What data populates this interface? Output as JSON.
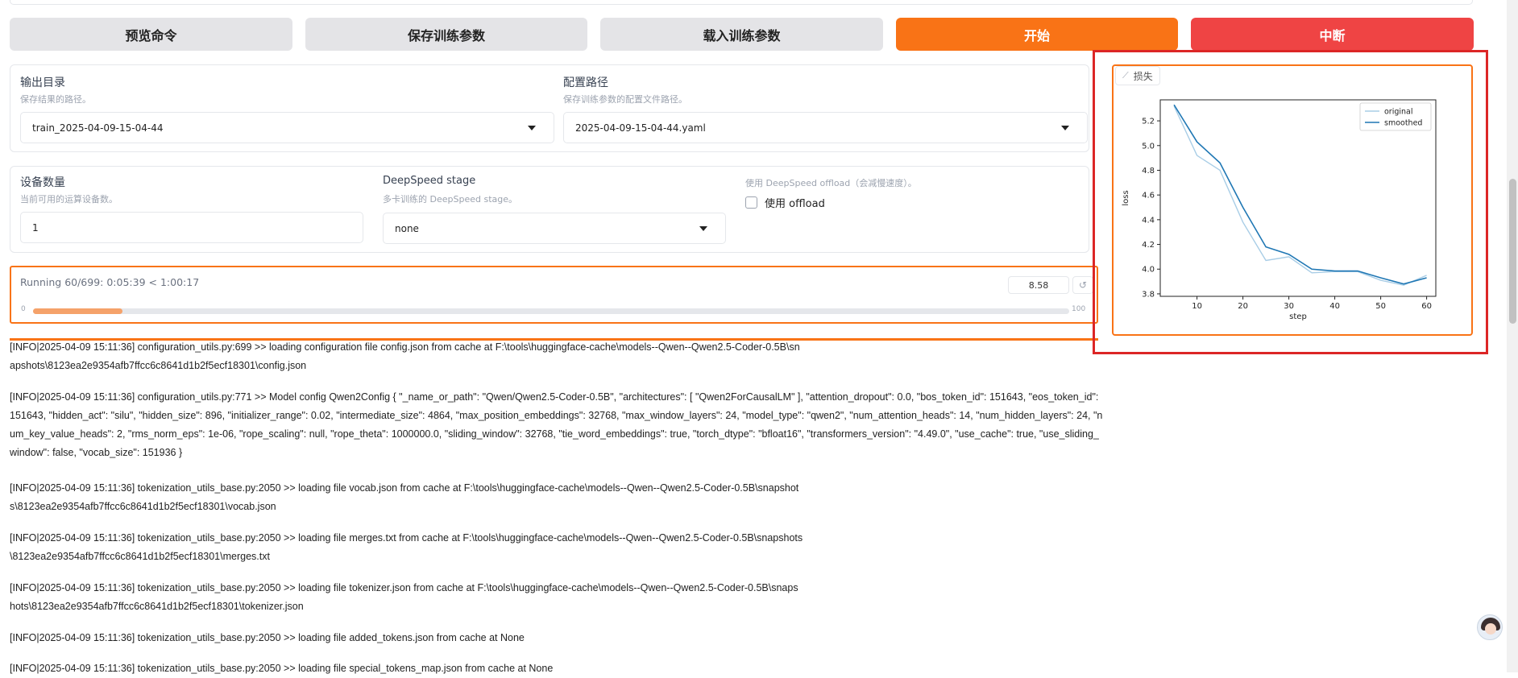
{
  "toolbar": {
    "preview_label": "预览命令",
    "save_label": "保存训练参数",
    "load_label": "载入训练参数",
    "start_label": "开始",
    "abort_label": "中断"
  },
  "output_dir": {
    "label": "输出目录",
    "info": "保存结果的路径。",
    "value": "train_2025-04-09-15-04-44"
  },
  "config_path": {
    "label": "配置路径",
    "info": "保存训练参数的配置文件路径。",
    "value": "2025-04-09-15-04-44.yaml"
  },
  "device_count": {
    "label": "设备数量",
    "info": "当前可用的运算设备数。",
    "value": "1"
  },
  "ds_stage": {
    "label": "DeepSpeed stage",
    "info": "多卡训练的 DeepSpeed stage。",
    "value": "none"
  },
  "ds_offload": {
    "info": "使用 DeepSpeed offload（会减慢速度）。",
    "label": "使用 offload",
    "checked": false
  },
  "progress": {
    "status": "Running 60/699: 0:05:39 < 1:00:17",
    "value_box": "8.58",
    "min_label": "0",
    "max_label": "100",
    "fraction": 0.086
  },
  "loss_panel": {
    "label": "损失",
    "highlight_color": "#dc2626",
    "accent_color": "#f97316"
  },
  "chart_data": {
    "type": "line",
    "xlabel": "step",
    "ylabel": "loss",
    "xlim": [
      2,
      62
    ],
    "ylim": [
      3.78,
      5.37
    ],
    "xticks": [
      "10",
      "20",
      "30",
      "40",
      "50",
      "60"
    ],
    "yticks": [
      "3.8",
      "4.0",
      "4.2",
      "4.4",
      "4.6",
      "4.8",
      "5.0",
      "5.2"
    ],
    "legend_position": "top-right",
    "series": [
      {
        "name": "original",
        "color": "#a8cde6",
        "x": [
          5,
          10,
          15,
          20,
          25,
          30,
          35,
          40,
          45,
          50,
          55,
          60
        ],
        "values": [
          5.32,
          4.92,
          4.8,
          4.38,
          4.07,
          4.1,
          3.97,
          3.98,
          3.98,
          3.91,
          3.87,
          3.95
        ]
      },
      {
        "name": "smoothed",
        "color": "#1f77b4",
        "x": [
          5,
          10,
          15,
          20,
          25,
          30,
          35,
          40,
          45,
          50,
          55,
          60
        ],
        "values": [
          5.33,
          5.03,
          4.86,
          4.5,
          4.18,
          4.12,
          4.0,
          3.985,
          3.985,
          3.93,
          3.88,
          3.93
        ]
      }
    ]
  },
  "logs": [
    "[INFO|2025-04-09 15:11:36] configuration_utils.py:699 >> loading configuration file config.json from cache at F:\\tools\\huggingface-cache\\models--Qwen--Qwen2.5-Coder-0.5B\\snapshots\\8123ea2e9354afb7ffcc6c8641d1b2f5ecf18301\\config.json",
    "[INFO|2025-04-09 15:11:36] configuration_utils.py:771 >> Model config Qwen2Config { \"_name_or_path\": \"Qwen/Qwen2.5-Coder-0.5B\", \"architectures\": [ \"Qwen2ForCausalLM\" ], \"attention_dropout\": 0.0, \"bos_token_id\": 151643, \"eos_token_id\": 151643, \"hidden_act\": \"silu\", \"hidden_size\": 896, \"initializer_range\": 0.02, \"intermediate_size\": 4864, \"max_position_embeddings\": 32768, \"max_window_layers\": 24, \"model_type\": \"qwen2\", \"num_attention_heads\": 14, \"num_hidden_layers\": 24, \"num_key_value_heads\": 2, \"rms_norm_eps\": 1e-06, \"rope_scaling\": null, \"rope_theta\": 1000000.0, \"sliding_window\": 32768, \"tie_word_embeddings\": true, \"torch_dtype\": \"bfloat16\", \"transformers_version\": \"4.49.0\", \"use_cache\": true, \"use_sliding_window\": false, \"vocab_size\": 151936 }",
    "[INFO|2025-04-09 15:11:36] tokenization_utils_base.py:2050 >> loading file vocab.json from cache at F:\\tools\\huggingface-cache\\models--Qwen--Qwen2.5-Coder-0.5B\\snapshots\\8123ea2e9354afb7ffcc6c8641d1b2f5ecf18301\\vocab.json",
    "[INFO|2025-04-09 15:11:36] tokenization_utils_base.py:2050 >> loading file merges.txt from cache at F:\\tools\\huggingface-cache\\models--Qwen--Qwen2.5-Coder-0.5B\\snapshots\\8123ea2e9354afb7ffcc6c8641d1b2f5ecf18301\\merges.txt",
    "[INFO|2025-04-09 15:11:36] tokenization_utils_base.py:2050 >> loading file tokenizer.json from cache at F:\\tools\\huggingface-cache\\models--Qwen--Qwen2.5-Coder-0.5B\\snapshots\\8123ea2e9354afb7ffcc6c8641d1b2f5ecf18301\\tokenizer.json",
    "[INFO|2025-04-09 15:11:36] tokenization_utils_base.py:2050 >> loading file added_tokens.json from cache at None",
    "[INFO|2025-04-09 15:11:36] tokenization_utils_base.py:2050 >> loading file special_tokens_map.json from cache at None"
  ]
}
